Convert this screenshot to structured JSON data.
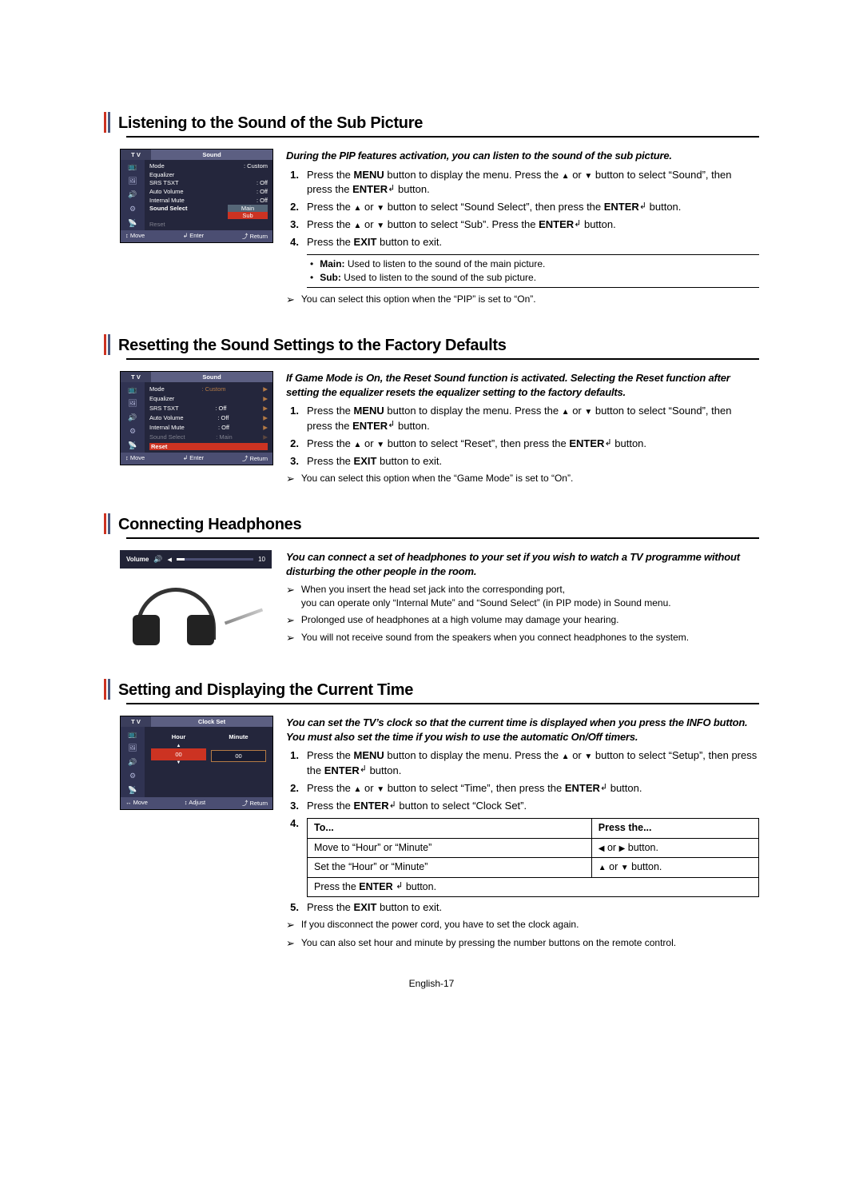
{
  "s1": {
    "title": "Listening to the Sound of the Sub Picture",
    "intro": "During the PIP features activation, you can listen to the sound of the sub picture.",
    "step1p1": "Press the ",
    "menu": "MENU",
    "step1p2": " button to display the menu. Press the ",
    "or": " or ",
    "step1p3": " button to select “Sound”, then press the ",
    "enter": "ENTER",
    "step1p4": " button.",
    "step2p1": "Press the ",
    "step2p2": " button to select “Sound Select”, then press the ",
    "step2p3": " button.",
    "step3p1": "Press the ",
    "step3p2": " button to select “Sub”. Press the ",
    "step3p3": " button.",
    "step4p1": "Press the ",
    "exit": "EXIT",
    "step4p2": " button to exit.",
    "bullet1a": "Main:",
    "bullet1b": " Used to listen to the sound of the main picture.",
    "bullet2a": "Sub:",
    "bullet2b": " Used to listen to the sound of the sub picture.",
    "note": "You can select this option when the “PIP” is set to “On”.",
    "menu_title": "Sound",
    "m_tv": "T V",
    "m_mode": "Mode",
    "m_mode_v": ": Custom",
    "m_eq": "Equalizer",
    "m_srs": "SRS TSXT",
    "m_off": ": Off",
    "m_av": "Auto Volume",
    "m_im": "Internal Mute",
    "m_ss": "Sound Select",
    "m_main": "Main",
    "m_sub": "Sub",
    "m_reset": "Reset",
    "nav_move": "↕ Move",
    "nav_enter": "↲ Enter",
    "nav_return": "⤴ Return"
  },
  "s2": {
    "title": "Resetting the Sound Settings to the Factory Defaults",
    "intro": "If Game Mode is On, the Reset Sound function is activated. Selecting the Reset function after setting the equalizer resets the equalizer setting to the factory defaults.",
    "step1p1": "Press the ",
    "menu": "MENU",
    "step1p2": " button to display the menu. Press the ",
    "or": " or ",
    "step1p3": " button to select “Sound”, then press the ",
    "enter": "ENTER",
    "step1p4": " button.",
    "step2p1": "Press the ",
    "step2p2": " button to select “Reset”, then press the ",
    "step2p3": " button.",
    "step3p1": "Press the ",
    "exit": "EXIT",
    "step3p2": " button to exit.",
    "note": "You can select this option when the “Game Mode” is set to “On”.",
    "m_ss_v": ": Main"
  },
  "s3": {
    "title": "Connecting Headphones",
    "intro": "You can connect a set of headphones to your set if you wish to watch a TV programme without disturbing the other people in the room.",
    "note1a": "When you insert the head set jack into the corresponding port,",
    "note1b": "you can operate only “Internal Mute” and “Sound Select” (in PIP mode) in Sound menu.",
    "note2": "Prolonged use of headphones at a high volume may damage your hearing.",
    "note3": "You will not receive sound from the speakers when you connect headphones to the system.",
    "vol_label": "Volume",
    "vol_value": "10"
  },
  "s4": {
    "title": "Setting and Displaying the Current Time",
    "intro": "You can set the TV’s clock so that the current time is displayed when you press the INFO button. You must also set the time if you wish to use the automatic On/Off timers.",
    "step1p1": "Press the ",
    "menu": "MENU",
    "step1p2": " button to display the menu. Press the ",
    "or": " or ",
    "step1p3": " button to select “Setup”, then press the ",
    "enter": "ENTER",
    "step1p4": " button.",
    "step2p1": "Press the ",
    "step2p2": " button to select “Time”, then press the ",
    "step2p3": " button.",
    "step3p1": "Press the ",
    "step3p2": " button to select “Clock Set”.",
    "th1": "To...",
    "th2": "Press the...",
    "r1c1": "Move to “Hour” or “Minute”",
    "r1c2a": "  or  ",
    "r1c2b": "  button.",
    "r2c1": "Set the “Hour” or “Minute”",
    "r2c2a": "  or  ",
    "r2c2b": "  button.",
    "r3c1a": "Press the ",
    "r3c1b": "ENTER",
    "r3c1c": "   button.",
    "step5p1": "Press the ",
    "exit": "EXIT",
    "step5p2": " button to exit.",
    "note1": "If you disconnect the power cord, you have to set the clock again.",
    "note2": "You can also set hour and minute by pressing the number buttons on the remote control.",
    "menu_title": "Clock Set",
    "m_tv": "T V",
    "hour": "Hour",
    "minute": "Minute",
    "h_v": "00",
    "m_v": "00",
    "nav_movelr": "↔ Move",
    "nav_adjust": "↕ Adjust",
    "nav_return": "⤴ Return"
  },
  "footer": "English-17"
}
